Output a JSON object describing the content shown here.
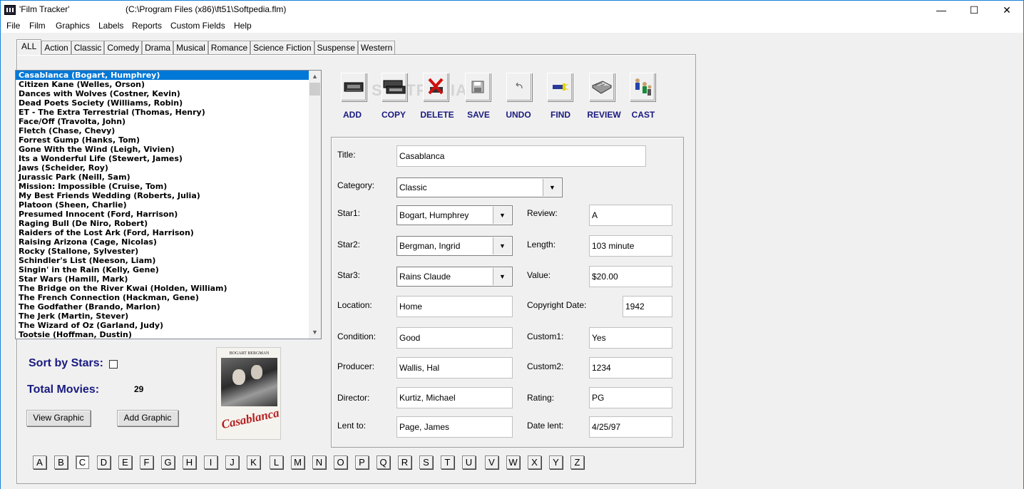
{
  "window": {
    "title": "'Film Tracker'",
    "path": "(C:\\Program Files (x86)\\ft51\\Softpedia.flm)",
    "minimize": "—",
    "maximize": "☐",
    "close": "✕"
  },
  "menu": [
    "File",
    "Film",
    "Graphics",
    "Labels",
    "Reports",
    "Custom Fields",
    "Help"
  ],
  "tabs": [
    "ALL",
    "Action",
    "Classic",
    "Comedy",
    "Drama",
    "Musical",
    "Romance",
    "Science Fiction",
    "Suspense",
    "Western"
  ],
  "active_tab": "ALL",
  "movies": [
    "Casablanca (Bogart, Humphrey)",
    "Citizen Kane (Welles, Orson)",
    "Dances with Wolves (Costner, Kevin)",
    "Dead Poets Society (Williams, Robin)",
    "ET - The Extra Terrestrial (Thomas, Henry)",
    "Face/Off (Travolta, John)",
    "Fletch (Chase, Chevy)",
    "Forrest Gump (Hanks, Tom)",
    "Gone With the Wind (Leigh, Vivien)",
    "Its a Wonderful Life (Stewert, James)",
    "Jaws (Scheider, Roy)",
    "Jurassic Park (Neill, Sam)",
    "Mission: Impossible (Cruise, Tom)",
    "My Best Friends Wedding (Roberts, Julia)",
    "Platoon (Sheen, Charlie)",
    "Presumed Innocent (Ford, Harrison)",
    "Raging Bull (De Niro, Robert)",
    "Raiders of the Lost Ark (Ford, Harrison)",
    "Raising Arizona (Cage, Nicolas)",
    "Rocky (Stallone, Sylvester)",
    "Schindler's List (Neeson, Liam)",
    "Singin' in the Rain (Kelly, Gene)",
    "Star Wars (Hamill, Mark)",
    "The Bridge on the River Kwai (Holden, William)",
    "The French Connection (Hackman, Gene)",
    "The Godfather (Brando, Marlon)",
    "The Jerk (Martin, Stever)",
    "The Wizard of Oz (Garland, Judy)",
    "Tootsie (Hoffman, Dustin)"
  ],
  "selected_movie_index": 0,
  "sort_by_stars_label": "Sort by Stars:",
  "total_movies_label": "Total Movies:",
  "total_movies": "29",
  "view_graphic": "View Graphic",
  "add_graphic": "Add Graphic",
  "poster": {
    "credits": "BOGART BERGMAN HENREID",
    "title": "Casablanca"
  },
  "letters": [
    "A",
    "B",
    "C",
    "D",
    "E",
    "F",
    "G",
    "H",
    "I",
    "J",
    "K",
    "L",
    "M",
    "N",
    "O",
    "P",
    "Q",
    "R",
    "S",
    "T",
    "U",
    "V",
    "W",
    "X",
    "Y",
    "Z"
  ],
  "active_letter": "C",
  "toolbar": [
    {
      "label": "ADD",
      "icon": "vhs-tape-icon"
    },
    {
      "label": "COPY",
      "icon": "vhs-copy-icon"
    },
    {
      "label": "DELETE",
      "icon": "red-x-icon"
    },
    {
      "label": "SAVE",
      "icon": "floppy-disk-icon"
    },
    {
      "label": "UNDO",
      "icon": "undo-arrow-icon"
    },
    {
      "label": "FIND",
      "icon": "flashlight-icon"
    },
    {
      "label": "REVIEW",
      "icon": "newspaper-icon"
    },
    {
      "label": "CAST",
      "icon": "people-icon"
    }
  ],
  "watermark": "SOFTPEDIA",
  "form": {
    "title_label": "Title:",
    "title": "Casablanca",
    "category_label": "Category:",
    "category": "Classic",
    "star1_label": "Star1:",
    "star1": "Bogart, Humphrey",
    "star2_label": "Star2:",
    "star2": "Bergman, Ingrid",
    "star3_label": "Star3:",
    "star3": "Rains Claude",
    "location_label": "Location:",
    "location": "Home",
    "condition_label": "Condition:",
    "condition": "Good",
    "producer_label": "Producer:",
    "producer": "Wallis, Hal",
    "director_label": "Director:",
    "director": "Kurtiz, Michael",
    "lent_to_label": "Lent to:",
    "lent_to": "Page, James",
    "review_label": "Review:",
    "review": "A",
    "length_label": "Length:",
    "length": "103 minute",
    "value_label": "Value:",
    "value": "$20.00",
    "copyright_label": "Copyright Date:",
    "copyright": "1942",
    "custom1_label": "Custom1:",
    "custom1": "Yes",
    "custom2_label": "Custom2:",
    "custom2": "1234",
    "rating_label": "Rating:",
    "rating": "PG",
    "date_lent_label": "Date lent:",
    "date_lent": "4/25/97"
  }
}
